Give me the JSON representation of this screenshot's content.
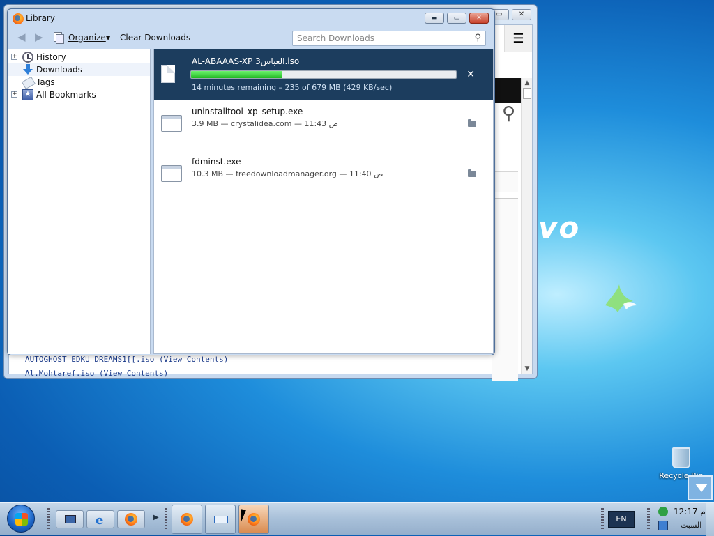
{
  "window": {
    "title": "Library",
    "controls": {
      "minimize": "▬",
      "maximize": "▭",
      "close": "✕"
    }
  },
  "toolbar": {
    "organize_label": "Organize",
    "clear_label": "Clear Downloads",
    "search_placeholder": "Search Downloads"
  },
  "sidebar": {
    "items": [
      {
        "label": "History",
        "icon": "history-clock-icon",
        "expandable": true
      },
      {
        "label": "Downloads",
        "icon": "downloads-arrow-icon",
        "expandable": false,
        "selected": true
      },
      {
        "label": "Tags",
        "icon": "tag-icon",
        "expandable": false
      },
      {
        "label": "All Bookmarks",
        "icon": "bookmarks-star-icon",
        "expandable": true
      }
    ]
  },
  "downloads": [
    {
      "name": "AL-ABAAAS-XP 3العباس.iso",
      "status": "14 minutes remaining – 235 of 679 MB (429 KB/sec)",
      "progress": 0.346,
      "active": true,
      "icon": "file-icon"
    },
    {
      "name": "uninstalltool_xp_setup.exe",
      "status": "3.9 MB — crystalidea.com — 11:43 ص",
      "active": false,
      "icon": "exe-icon"
    },
    {
      "name": "fdminst.exe",
      "status": "10.3 MB — freedownloadmanager.org — 11:40 ص",
      "active": false,
      "icon": "exe-icon"
    }
  ],
  "background_page": {
    "lines": [
      "AUTOGHOST EDKU DREAMS1[[.iso (View Contents)",
      "Al.Mohtaref.iso (View Contents)"
    ]
  },
  "desktop": {
    "brand_text": "vo",
    "recycle_bin_label": "Recycle Bin"
  },
  "taskbar": {
    "language": "EN",
    "clock_time": "12:17 م",
    "clock_day": "السبت"
  },
  "colors": {
    "active_row_bg": "#1c3d5e",
    "progress_fill": "#22b822",
    "desktop_blue": "#1e8ddb"
  }
}
